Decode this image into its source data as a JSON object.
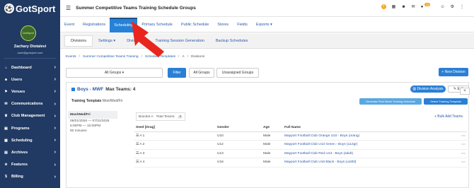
{
  "app": {
    "logo_text": "GotSport",
    "page_title": "Summer Competitive Teams Training Schedule Groups"
  },
  "user": {
    "avatar_text": "GotSport",
    "name": "Zachary Diotalevi",
    "email": "zach@gotsport.com"
  },
  "topbar": {
    "help_icon": "?",
    "notification_badge": "11"
  },
  "sidebar": {
    "items": [
      {
        "label": "Dashboard",
        "icon": "dashboard-icon",
        "glyph": "⌂"
      },
      {
        "label": "Users",
        "icon": "users-icon",
        "glyph": "☻"
      },
      {
        "label": "Venues",
        "icon": "venue-icon",
        "glyph": "⚑"
      },
      {
        "label": "Communications",
        "icon": "chat-icon",
        "glyph": "✉"
      },
      {
        "label": "Club Management",
        "icon": "club-icon",
        "glyph": "♛"
      },
      {
        "label": "Programs",
        "icon": "programs-icon",
        "glyph": "▣"
      },
      {
        "label": "Scheduling",
        "icon": "calendar-icon",
        "glyph": "▦"
      },
      {
        "label": "Archives",
        "icon": "archive-icon",
        "glyph": "▤"
      },
      {
        "label": "Features",
        "icon": "star-icon",
        "glyph": "★"
      },
      {
        "label": "Billing",
        "icon": "billing-icon",
        "glyph": "$"
      }
    ]
  },
  "tabs": [
    {
      "label": "Event",
      "active": false
    },
    {
      "label": "Registrations",
      "active": false
    },
    {
      "label": "Scheduling",
      "active": true
    },
    {
      "label": "Primary Schedule",
      "active": false
    },
    {
      "label": "Public Schedule",
      "active": false
    },
    {
      "label": "Stores",
      "active": false
    },
    {
      "label": "Fields",
      "active": false
    },
    {
      "label": "Exports ▾",
      "active": false
    }
  ],
  "subtabs": [
    {
      "label": "Divisions",
      "active": true
    },
    {
      "label": "Settings ▾",
      "active": false
    },
    {
      "label": "Division A",
      "active": false
    },
    {
      "label": "Training Session Generation",
      "active": false
    },
    {
      "label": "Backup Schedules",
      "active": false
    }
  ],
  "breadcrumb": [
    "Events",
    "Summer Competitive Teams Training",
    "Schedule Templates",
    "A",
    "Divisions"
  ],
  "filters": {
    "group_select": "All Groups ▾",
    "filter_label": "Filter",
    "all_groups_label": "All Groups",
    "unassigned_label": "Unassigned Groups",
    "new_division_label": "+ New Division"
  },
  "division": {
    "name_link": "Boys - MWF",
    "max_teams": "Max Teams: 4",
    "analysis_label": "Division Analysis",
    "edit_label": "Edit",
    "training_template_label": "Training Template",
    "training_template_value": "Mon/Wed/Fri",
    "generate_label": "Generate First Week Training Schedule",
    "select_template_label": "Select Training Template",
    "schedule": {
      "days": "Mon/Wed/Fri",
      "dates": "06/01/2026 — 07/31/2026",
      "time": "5:00PM — 10:00PM",
      "duration": "60 minutes"
    },
    "bracket_label": "Bracket A",
    "total_teams_label": "Total Teams:",
    "total_teams_value": "4",
    "bulk_add_label": "+ Bulk Add Teams",
    "columns": [
      "Seed [Drag]",
      "Gender",
      "Age",
      "Full Name"
    ],
    "rows": [
      {
        "seed": "☰ A 1",
        "gender": "U10",
        "age": "Male",
        "name": "Mayport Football Club Orange U10 - Boys (orang)"
      },
      {
        "seed": "☰ A 2",
        "gender": "U12",
        "age": "Male",
        "name": "Mayport Football Club U13 Green - Boys (u12gr)"
      },
      {
        "seed": "☰ A 3",
        "gender": "U13",
        "age": "Male",
        "name": "Mayport Football Club Red U13 - Boys (adult)"
      },
      {
        "seed": "☰ A 4",
        "gender": "U16",
        "age": "Male",
        "name": "Mayport Football Club U16 Black - Boys (u16bl)"
      }
    ]
  },
  "colors": {
    "sidebar": "#213a63",
    "accent": "#2582d6",
    "arrow": "#e8261d"
  }
}
